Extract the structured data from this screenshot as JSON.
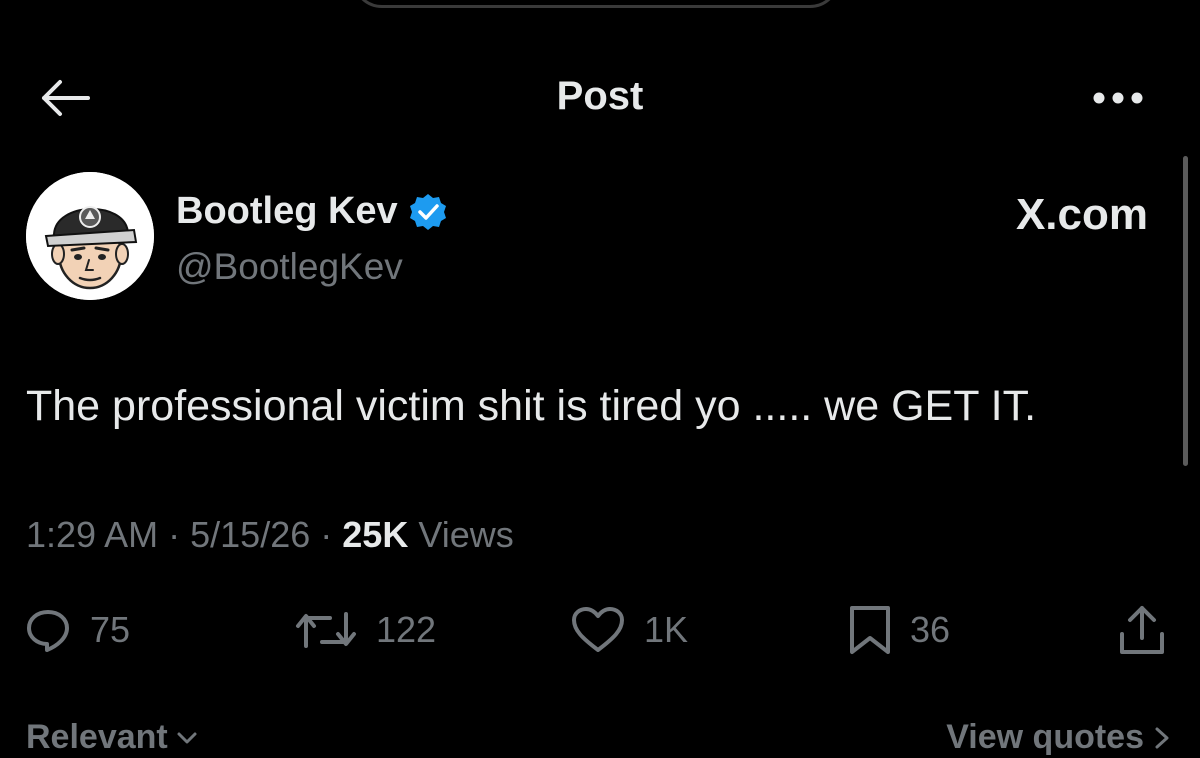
{
  "header": {
    "title": "Post",
    "back_icon": "back-arrow-icon",
    "more_icon": "more-horizontal-icon"
  },
  "author": {
    "name": "Bootleg Kev",
    "handle": "@BootlegKev",
    "verified": true,
    "verified_badge_color": "#1d9bf0",
    "source": "X.com"
  },
  "post": {
    "text": "The professional victim shit is tired yo ..... we GET IT.",
    "time": "1:29 AM",
    "separator": "·",
    "date": "5/15/26",
    "views_count": "25K",
    "views_label": "Views"
  },
  "actions": {
    "replies": "75",
    "reposts": "122",
    "likes": "1K",
    "bookmarks": "36"
  },
  "bottom": {
    "sort_label": "Relevant",
    "view_quotes_label": "View quotes"
  },
  "colors": {
    "background": "#000000",
    "primary_text": "#e7e9ea",
    "secondary_text": "#71767b",
    "verified_blue": "#1d9bf0"
  }
}
